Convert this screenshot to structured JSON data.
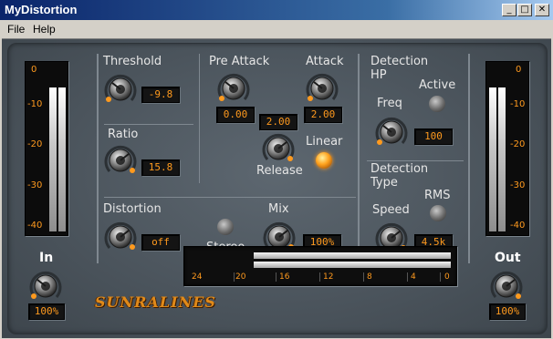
{
  "window": {
    "title": "MyDistortion",
    "minimize": "_",
    "maximize": "□",
    "close": "✕"
  },
  "menu": {
    "file": "File",
    "help": "Help"
  },
  "meters": {
    "scale": [
      "0",
      "-10",
      "-20",
      "-30",
      "-40"
    ],
    "in": {
      "label": "In",
      "value": "100%",
      "level_left": 0.88,
      "level_right": 0.88
    },
    "out": {
      "label": "Out",
      "value": "100%",
      "level_left": 0.88,
      "level_right": 0.88
    }
  },
  "threshold": {
    "label": "Threshold",
    "value": "-9.8"
  },
  "ratio": {
    "label": "Ratio",
    "value": "15.8"
  },
  "pre_attack": {
    "label": "Pre Attack",
    "value": "0.00"
  },
  "attack": {
    "label": "Attack",
    "value": "2.00"
  },
  "release": {
    "label": "Release",
    "value": "2.00"
  },
  "linear": {
    "label": "Linear",
    "state": "on"
  },
  "detection_hp": {
    "label_line1": "Detection",
    "label_line2": "HP",
    "freq_label": "Freq",
    "freq_value": "100",
    "active_label": "Active",
    "active_state": "off"
  },
  "detection_type": {
    "label_line1": "Detection",
    "label_line2": "Type",
    "speed_label": "Speed",
    "speed_value": "4.5k",
    "rms_label": "RMS",
    "rms_state": "off"
  },
  "distortion": {
    "label": "Distortion",
    "value": "off"
  },
  "stereo": {
    "label": "Stereo",
    "state": "off"
  },
  "mix": {
    "label": "Mix",
    "value": "100%"
  },
  "brand": "SUNRALINES",
  "gain_reduction": {
    "ticks": [
      "24",
      "20",
      "16",
      "12",
      "8",
      "4",
      "0"
    ],
    "level_top": 1.0,
    "level_bottom": 1.0
  },
  "colors": {
    "display_text": "#ff9a1e",
    "panel": "#4f5860",
    "led_on": "#ffa21e"
  }
}
